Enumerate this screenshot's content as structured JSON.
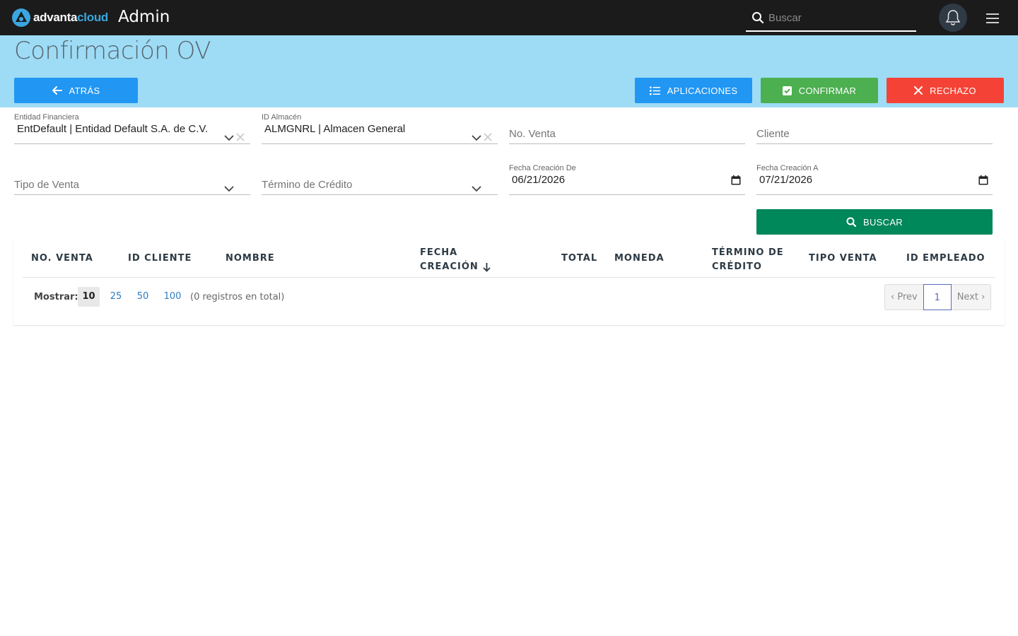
{
  "topbar": {
    "logo_text_main": "advanta",
    "logo_text_accent": "cloud",
    "app_title": "Admin",
    "search_placeholder": "Buscar"
  },
  "page": {
    "title": "Confirmación OV"
  },
  "actions": {
    "back_label": "ATRÁS",
    "apps_label": "APLICACIONES",
    "confirm_label": "CONFIRMAR",
    "reject_label": "RECHAZO"
  },
  "filters": {
    "entidad": {
      "label": "Entidad Financiera",
      "value": "EntDefault | Entidad Default S.A. de C.V."
    },
    "almacen": {
      "label": "ID Almacén",
      "value": "ALMGNRL | Almacen General"
    },
    "no_venta": {
      "placeholder": "No. Venta"
    },
    "cliente": {
      "placeholder": "Cliente"
    },
    "tipo_venta": {
      "placeholder": "Tipo de Venta"
    },
    "termino_credito": {
      "placeholder": "Término de Crédito"
    },
    "fecha_de": {
      "label": "Fecha Creación De",
      "value": "06/21/2026"
    },
    "fecha_a": {
      "label": "Fecha Creación A",
      "value": "07/21/2026"
    },
    "search_label": "BUSCAR"
  },
  "table": {
    "columns": [
      {
        "label": "NO. VENTA"
      },
      {
        "label": "ID CLIENTE"
      },
      {
        "label": "NOMBRE"
      },
      {
        "label": "FECHA",
        "label2": "CREACIÓN",
        "sorted": "desc"
      },
      {
        "label": "TOTAL"
      },
      {
        "label": "MONEDA"
      },
      {
        "label": "TÉRMINO DE",
        "label2": "CRÉDITO"
      },
      {
        "label": "TIPO VENTA"
      },
      {
        "label": "ID EMPLEADO"
      }
    ],
    "rows": []
  },
  "pagination": {
    "show_label": "Mostrar:",
    "page_sizes": [
      "10",
      "25",
      "50",
      "100"
    ],
    "selected_size": "10",
    "total_text": "(0 registros en total)",
    "prev_label": "‹ Prev",
    "current_page": "1",
    "next_label": "Next ›"
  },
  "colors": {
    "topbar": "#1b1b1b",
    "band": "#9edcf6",
    "primary": "#2196f3",
    "success": "#4caf50",
    "danger": "#f44336",
    "search": "#00875a"
  }
}
